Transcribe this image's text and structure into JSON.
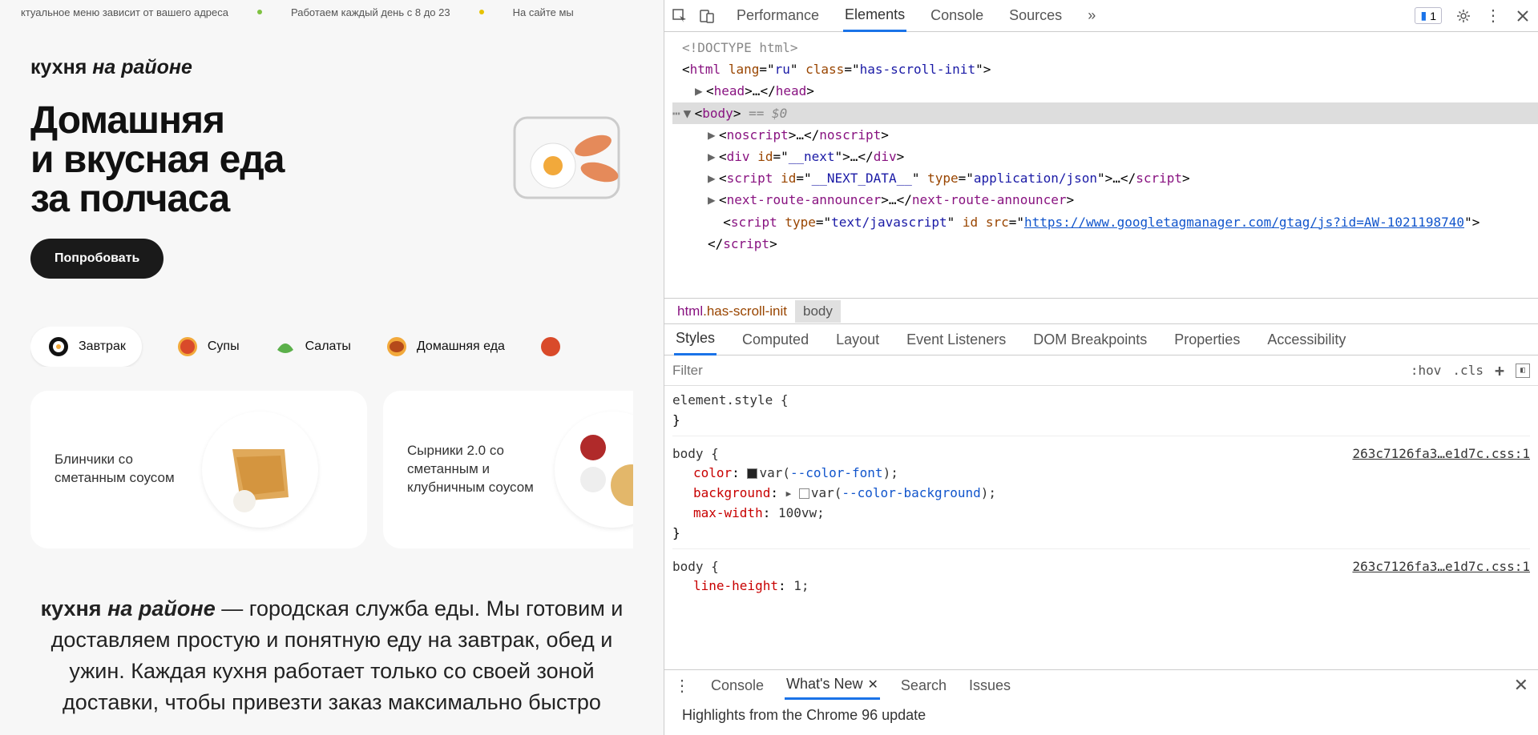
{
  "ticker": {
    "t1": "ктуальное меню зависит от вашего адреса",
    "t2": "Работаем каждый день с 8 до 23",
    "t3": "На сайте мы "
  },
  "brand": {
    "part1": "кухня ",
    "part2": "на районе"
  },
  "headline": {
    "l1": "Домашняя",
    "l2": "и вкусная еда",
    "l3": "за полчаса"
  },
  "cta_label": "Попробовать",
  "categories": [
    {
      "label": "Завтрак"
    },
    {
      "label": "Супы"
    },
    {
      "label": "Салаты"
    },
    {
      "label": "Домашняя еда"
    }
  ],
  "cards": [
    {
      "title": "Блинчики со сметанным соусом"
    },
    {
      "title": "Сырники 2.0 со сметанным и клубничным соусом"
    }
  ],
  "desc": {
    "brand1": "кухня ",
    "brand2": "на районе",
    "rest": " — городская служба еды. Мы готовим и доставляем простую и понятную еду на завтрак, обед и ужин. Каждая кухня работает только со своей зоной доставки, чтобы привезти заказ максимально быстро"
  },
  "devtools": {
    "top_tabs": {
      "performance": "Performance",
      "elements": "Elements",
      "console": "Console",
      "sources": "Sources",
      "more": "»"
    },
    "issues_count": "1",
    "dom": {
      "doctype": "<!DOCTYPE html>",
      "html_open": {
        "tag": "html",
        "attrs": [
          [
            "lang",
            "ru"
          ],
          [
            "class",
            "has-scroll-init"
          ]
        ]
      },
      "head": {
        "tag": "head"
      },
      "body_sel": {
        "tag": "body",
        "anno": "== $0"
      },
      "noscript": {
        "tag": "noscript"
      },
      "next_div": {
        "tag": "div",
        "attrs": [
          [
            "id",
            "__next"
          ]
        ]
      },
      "next_data": {
        "tag": "script",
        "attrs": [
          [
            "id",
            "__NEXT_DATA__"
          ],
          [
            "type",
            "application/json"
          ]
        ]
      },
      "announcer": {
        "tag": "next-route-announcer"
      },
      "gtm": {
        "tag": "script",
        "attrs": [
          [
            "type",
            "text/javascript"
          ],
          [
            "id",
            ""
          ]
        ],
        "src_label": "src",
        "src": "https://www.googletagmanager.com/gtag/js?id=AW-1021198740"
      }
    },
    "crumbs": {
      "c1_tag": "html",
      "c1_cls": ".has-scroll-init",
      "c2": "body"
    },
    "styles_tabs": {
      "styles": "Styles",
      "computed": "Computed",
      "layout": "Layout",
      "eventlisteners": "Event Listeners",
      "dombp": "DOM Breakpoints",
      "properties": "Properties",
      "accessibility": "Accessibility"
    },
    "filter_placeholder": "Filter",
    "filter_controls": {
      "hov": ":hov",
      "cls": ".cls"
    },
    "rules": {
      "el_style": "element.style",
      "r1": {
        "selector": "body",
        "source": "263c7126fa3…e1d7c.css:1",
        "props": [
          {
            "name": "color",
            "var": "--color-font",
            "swatch": "dark"
          },
          {
            "name": "background",
            "var": "--color-background",
            "swatch": "white",
            "expand": true
          },
          {
            "name": "max-width",
            "value": "100vw"
          }
        ]
      },
      "r2": {
        "selector": "body",
        "source": "263c7126fa3…e1d7c.css:1",
        "props": [
          {
            "name": "line-height",
            "value": "1"
          }
        ]
      }
    },
    "drawer": {
      "tabs": {
        "console": "Console",
        "whatsnew": "What's New",
        "search": "Search",
        "issues": "Issues"
      },
      "headline": "Highlights from the Chrome 96 update"
    }
  }
}
